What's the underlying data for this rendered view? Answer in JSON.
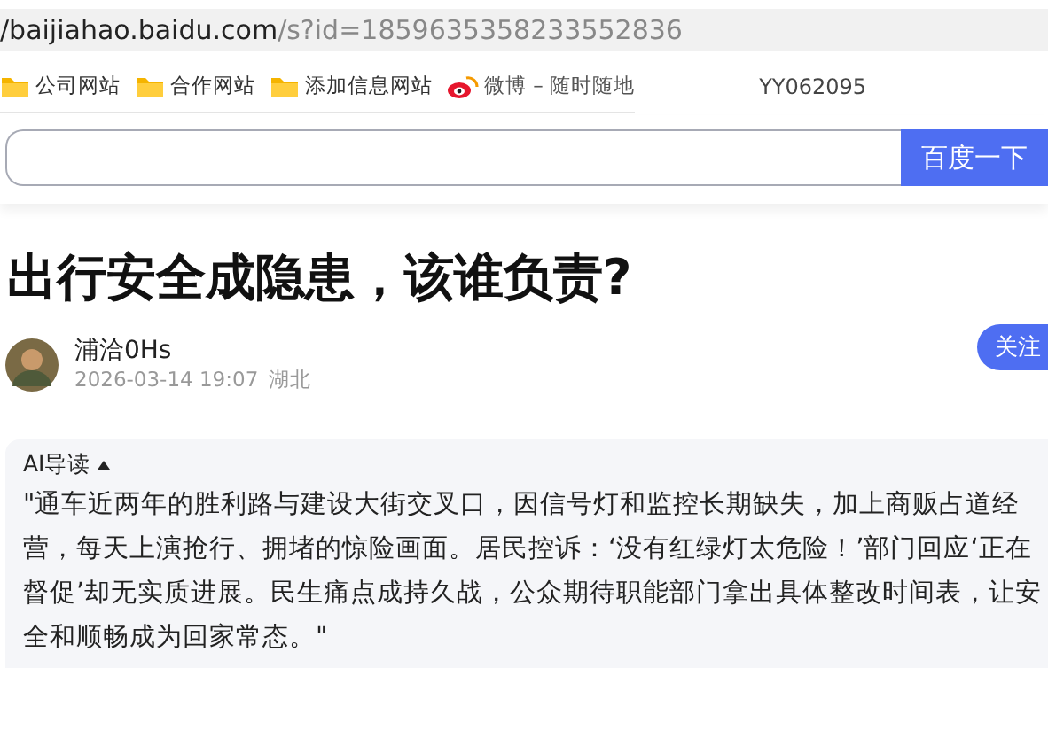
{
  "address_bar": {
    "host": "/baijiahao.baidu.com",
    "path": "/s?id=1859635358233552836"
  },
  "bookmarks": [
    {
      "kind": "folder",
      "label": "公司网站"
    },
    {
      "kind": "folder",
      "label": "合作网站"
    },
    {
      "kind": "folder",
      "label": "添加信息网站"
    },
    {
      "kind": "weibo",
      "label": "微博 – 随时随地"
    }
  ],
  "profile_label": "YY062095",
  "search": {
    "button": "百度一下"
  },
  "article": {
    "title": "出行安全成隐患，该谁负责?",
    "author": "浦洽0Hs",
    "date": "2026-03-14 19:07",
    "location": "湖北",
    "follow": "关注"
  },
  "ai_summary": {
    "heading": "AI导读",
    "expanded": true,
    "text": "\"通车近两年的胜利路与建设大街交叉口，因信号灯和监控长期缺失，加上商贩占道经营，每天上演抢行、拥堵的惊险画面。居民控诉：‘没有红绿灯太危险！’部门回应‘正在督促’却无实质进展。民生痛点成持久战，公众期待职能部门拿出具体整改时间表，让安全和顺畅成为回家常态。\""
  }
}
